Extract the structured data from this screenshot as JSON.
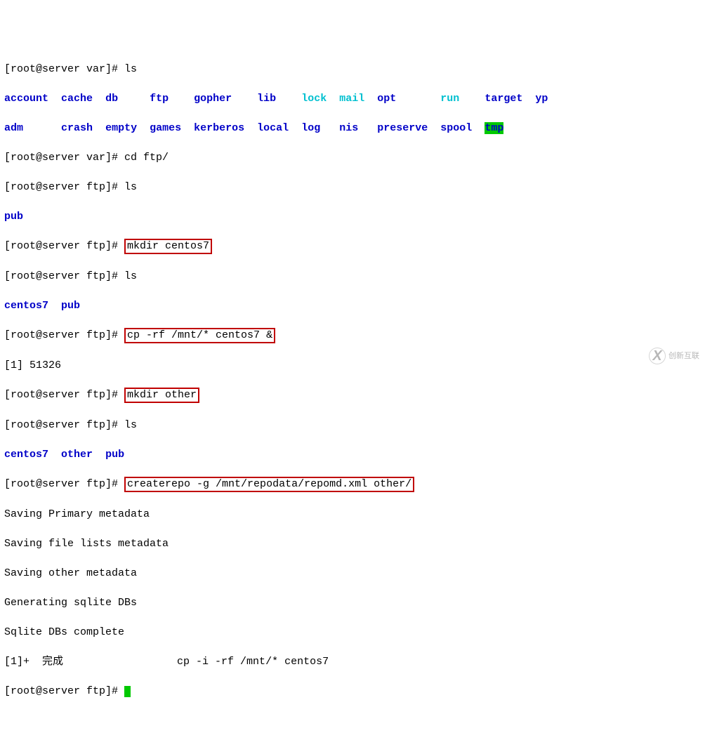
{
  "prompts": {
    "p_var": "[root@server var]# ",
    "p_ftp": "[root@server ftp]# "
  },
  "cmds": {
    "ls": "ls",
    "cd_ftp": "cd ftp/",
    "mkdir_centos7": "mkdir centos7",
    "cp_mnt": "cp -rf /mnt/* centos7 &",
    "mkdir_other": "mkdir other",
    "createrepo": "createrepo -g /mnt/repodata/repomd.xml other/"
  },
  "ls_var": {
    "r1c1": "account",
    "r1c2": "cache",
    "r1c3": "db",
    "r1c4": "ftp",
    "r1c5": "gopher",
    "r1c6": "lib",
    "r1c7": "lock",
    "r1c8": "mail",
    "r1c9": "opt",
    "r1c10": "run",
    "r1c11": "target",
    "r1c12": "yp",
    "r2c1": "adm",
    "r2c2": "crash",
    "r2c3": "empty",
    "r2c4": "games",
    "r2c5": "kerberos",
    "r2c6": "local",
    "r2c7": "log",
    "r2c8": "nis",
    "r2c9": "preserve",
    "r2c10": "spool",
    "r2c11": "tmp"
  },
  "ls_ftp1": {
    "pub": "pub"
  },
  "ls_ftp2": {
    "centos7": "centos7",
    "pub": "pub"
  },
  "ls_ftp3": {
    "centos7": "centos7",
    "other": "other",
    "pub": "pub"
  },
  "bgjob": "[1] 51326",
  "createrepo_out": {
    "l1": "Saving Primary metadata",
    "l2": "Saving file lists metadata",
    "l3": "Saving other metadata",
    "l4": "Generating sqlite DBs",
    "l5": "Sqlite DBs complete"
  },
  "done_line": {
    "prefix": "[1]+  完成",
    "rest": "                  cp -i -rf /mnt/* centos7"
  },
  "watermark": {
    "icon": "X",
    "text": "创新互联"
  }
}
